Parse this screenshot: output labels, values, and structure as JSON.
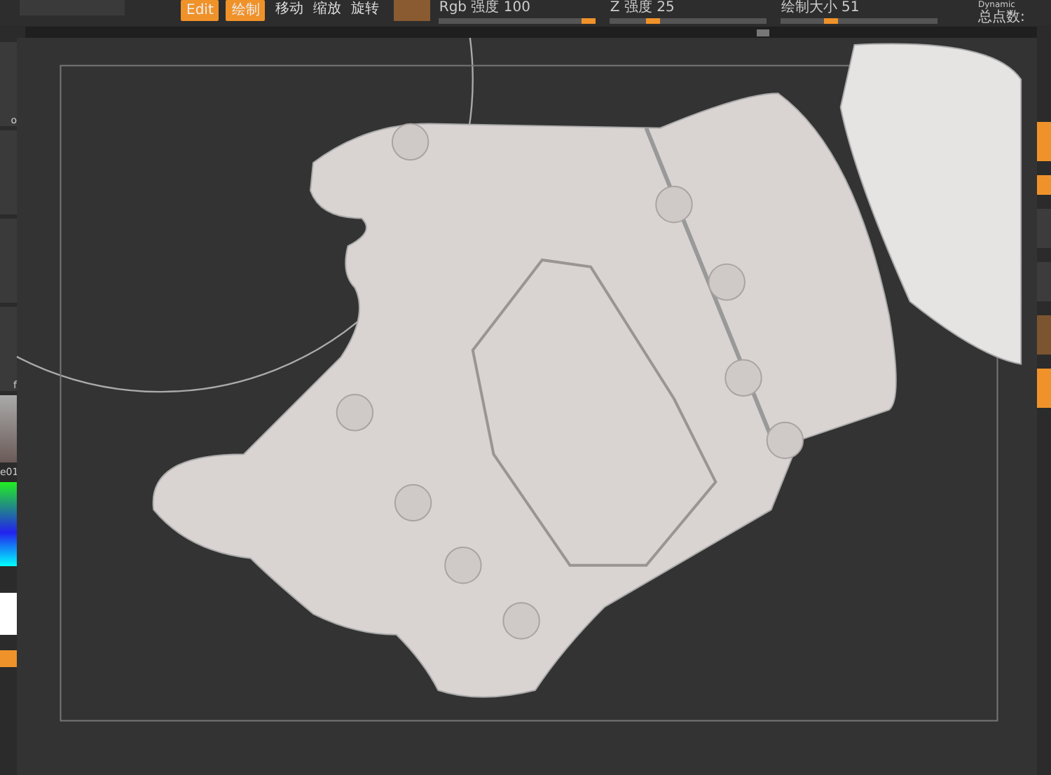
{
  "toolbar": {
    "buttons": [
      {
        "label": "Edit",
        "selected": true
      },
      {
        "label": "绘制",
        "selected": true
      }
    ],
    "tools": [
      "移动",
      "缩放",
      "旋转"
    ],
    "sliders": [
      {
        "label": "Rgb 强度 100",
        "level": 1.0
      },
      {
        "label": "Z 强度 25",
        "level": 0.25
      },
      {
        "label": "绘制大小 51",
        "level": 0.3
      }
    ],
    "mode": "Dynamic",
    "points_label": "总点数:"
  },
  "left_tray": {
    "labels": [
      "o",
      "f",
      "e01"
    ]
  }
}
